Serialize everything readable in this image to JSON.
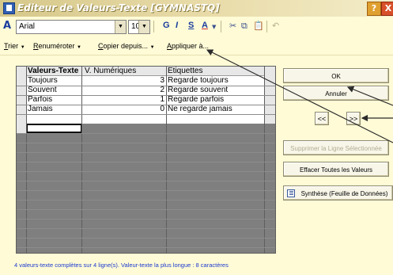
{
  "window": {
    "title": "Editeur de Valeurs-Texte [GYMNASTQ]",
    "help_label": "?",
    "close_label": "X"
  },
  "format_toolbar": {
    "font_name": "Arial",
    "font_size": "10",
    "font_icon": "font-a-icon",
    "bold_label": "G",
    "italic_label": "I",
    "underline_label": "S",
    "color_label": "A",
    "icons": [
      "cut-icon",
      "copy-icon",
      "paste-icon",
      "undo-icon"
    ],
    "icon_glyphs": {
      "cut": "✂",
      "copy": "⧉",
      "paste": "📋",
      "undo": "↶"
    }
  },
  "action_toolbar": {
    "sort": {
      "key": "T",
      "rest": "rier",
      "arrow": "▼"
    },
    "renumber": {
      "key": "R",
      "rest": "enuméroter",
      "arrow": "▼"
    },
    "copy_from": {
      "key": "C",
      "rest": "opier depuis...",
      "arrow": "▼"
    },
    "apply_to": {
      "key": "A",
      "rest": "ppliquer à..."
    }
  },
  "table": {
    "headers": [
      "Valeurs-Texte",
      "V. Numériques",
      "Etiquettes"
    ],
    "rows": [
      {
        "text": "Toujours",
        "num": "3",
        "label": "Regarde toujours"
      },
      {
        "text": "Souvent",
        "num": "2",
        "label": "Regarde souvent"
      },
      {
        "text": "Parfois",
        "num": "1",
        "label": "Regarde parfois"
      },
      {
        "text": "Jamais",
        "num": "0",
        "label": "Ne regarde jamais"
      }
    ],
    "new_row_marker": "*"
  },
  "buttons": {
    "ok": "OK",
    "cancel": "Annuler",
    "prev": "<<",
    "next": ">>",
    "delete_row": "Supprimer la Ligne Sélectionnée",
    "clear_all": "Effacer Toutes les Valeurs",
    "synthesis": "Synthèse (Feuille de Données)"
  },
  "status": "4 valeurs-texte complètes sur 4 ligne(s). Valeur-texte la plus longue : 8 caractères",
  "colors": {
    "background": "#fffbd6",
    "grid_empty": "#7f7f7f",
    "status_text": "#1a3ad0",
    "title_bar": "#d6c88a"
  }
}
